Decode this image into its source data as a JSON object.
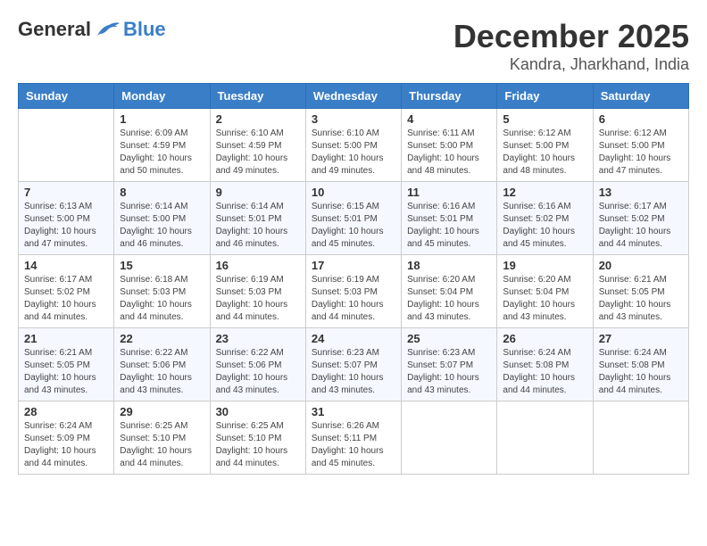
{
  "logo": {
    "general": "General",
    "blue": "Blue"
  },
  "title": "December 2025",
  "location": "Kandra, Jharkhand, India",
  "days_of_week": [
    "Sunday",
    "Monday",
    "Tuesday",
    "Wednesday",
    "Thursday",
    "Friday",
    "Saturday"
  ],
  "weeks": [
    [
      {
        "day": "",
        "info": ""
      },
      {
        "day": "1",
        "info": "Sunrise: 6:09 AM\nSunset: 4:59 PM\nDaylight: 10 hours\nand 50 minutes."
      },
      {
        "day": "2",
        "info": "Sunrise: 6:10 AM\nSunset: 4:59 PM\nDaylight: 10 hours\nand 49 minutes."
      },
      {
        "day": "3",
        "info": "Sunrise: 6:10 AM\nSunset: 5:00 PM\nDaylight: 10 hours\nand 49 minutes."
      },
      {
        "day": "4",
        "info": "Sunrise: 6:11 AM\nSunset: 5:00 PM\nDaylight: 10 hours\nand 48 minutes."
      },
      {
        "day": "5",
        "info": "Sunrise: 6:12 AM\nSunset: 5:00 PM\nDaylight: 10 hours\nand 48 minutes."
      },
      {
        "day": "6",
        "info": "Sunrise: 6:12 AM\nSunset: 5:00 PM\nDaylight: 10 hours\nand 47 minutes."
      }
    ],
    [
      {
        "day": "7",
        "info": "Sunrise: 6:13 AM\nSunset: 5:00 PM\nDaylight: 10 hours\nand 47 minutes."
      },
      {
        "day": "8",
        "info": "Sunrise: 6:14 AM\nSunset: 5:00 PM\nDaylight: 10 hours\nand 46 minutes."
      },
      {
        "day": "9",
        "info": "Sunrise: 6:14 AM\nSunset: 5:01 PM\nDaylight: 10 hours\nand 46 minutes."
      },
      {
        "day": "10",
        "info": "Sunrise: 6:15 AM\nSunset: 5:01 PM\nDaylight: 10 hours\nand 45 minutes."
      },
      {
        "day": "11",
        "info": "Sunrise: 6:16 AM\nSunset: 5:01 PM\nDaylight: 10 hours\nand 45 minutes."
      },
      {
        "day": "12",
        "info": "Sunrise: 6:16 AM\nSunset: 5:02 PM\nDaylight: 10 hours\nand 45 minutes."
      },
      {
        "day": "13",
        "info": "Sunrise: 6:17 AM\nSunset: 5:02 PM\nDaylight: 10 hours\nand 44 minutes."
      }
    ],
    [
      {
        "day": "14",
        "info": "Sunrise: 6:17 AM\nSunset: 5:02 PM\nDaylight: 10 hours\nand 44 minutes."
      },
      {
        "day": "15",
        "info": "Sunrise: 6:18 AM\nSunset: 5:03 PM\nDaylight: 10 hours\nand 44 minutes."
      },
      {
        "day": "16",
        "info": "Sunrise: 6:19 AM\nSunset: 5:03 PM\nDaylight: 10 hours\nand 44 minutes."
      },
      {
        "day": "17",
        "info": "Sunrise: 6:19 AM\nSunset: 5:03 PM\nDaylight: 10 hours\nand 44 minutes."
      },
      {
        "day": "18",
        "info": "Sunrise: 6:20 AM\nSunset: 5:04 PM\nDaylight: 10 hours\nand 43 minutes."
      },
      {
        "day": "19",
        "info": "Sunrise: 6:20 AM\nSunset: 5:04 PM\nDaylight: 10 hours\nand 43 minutes."
      },
      {
        "day": "20",
        "info": "Sunrise: 6:21 AM\nSunset: 5:05 PM\nDaylight: 10 hours\nand 43 minutes."
      }
    ],
    [
      {
        "day": "21",
        "info": "Sunrise: 6:21 AM\nSunset: 5:05 PM\nDaylight: 10 hours\nand 43 minutes."
      },
      {
        "day": "22",
        "info": "Sunrise: 6:22 AM\nSunset: 5:06 PM\nDaylight: 10 hours\nand 43 minutes."
      },
      {
        "day": "23",
        "info": "Sunrise: 6:22 AM\nSunset: 5:06 PM\nDaylight: 10 hours\nand 43 minutes."
      },
      {
        "day": "24",
        "info": "Sunrise: 6:23 AM\nSunset: 5:07 PM\nDaylight: 10 hours\nand 43 minutes."
      },
      {
        "day": "25",
        "info": "Sunrise: 6:23 AM\nSunset: 5:07 PM\nDaylight: 10 hours\nand 43 minutes."
      },
      {
        "day": "26",
        "info": "Sunrise: 6:24 AM\nSunset: 5:08 PM\nDaylight: 10 hours\nand 44 minutes."
      },
      {
        "day": "27",
        "info": "Sunrise: 6:24 AM\nSunset: 5:08 PM\nDaylight: 10 hours\nand 44 minutes."
      }
    ],
    [
      {
        "day": "28",
        "info": "Sunrise: 6:24 AM\nSunset: 5:09 PM\nDaylight: 10 hours\nand 44 minutes."
      },
      {
        "day": "29",
        "info": "Sunrise: 6:25 AM\nSunset: 5:10 PM\nDaylight: 10 hours\nand 44 minutes."
      },
      {
        "day": "30",
        "info": "Sunrise: 6:25 AM\nSunset: 5:10 PM\nDaylight: 10 hours\nand 44 minutes."
      },
      {
        "day": "31",
        "info": "Sunrise: 6:26 AM\nSunset: 5:11 PM\nDaylight: 10 hours\nand 45 minutes."
      },
      {
        "day": "",
        "info": ""
      },
      {
        "day": "",
        "info": ""
      },
      {
        "day": "",
        "info": ""
      }
    ]
  ]
}
